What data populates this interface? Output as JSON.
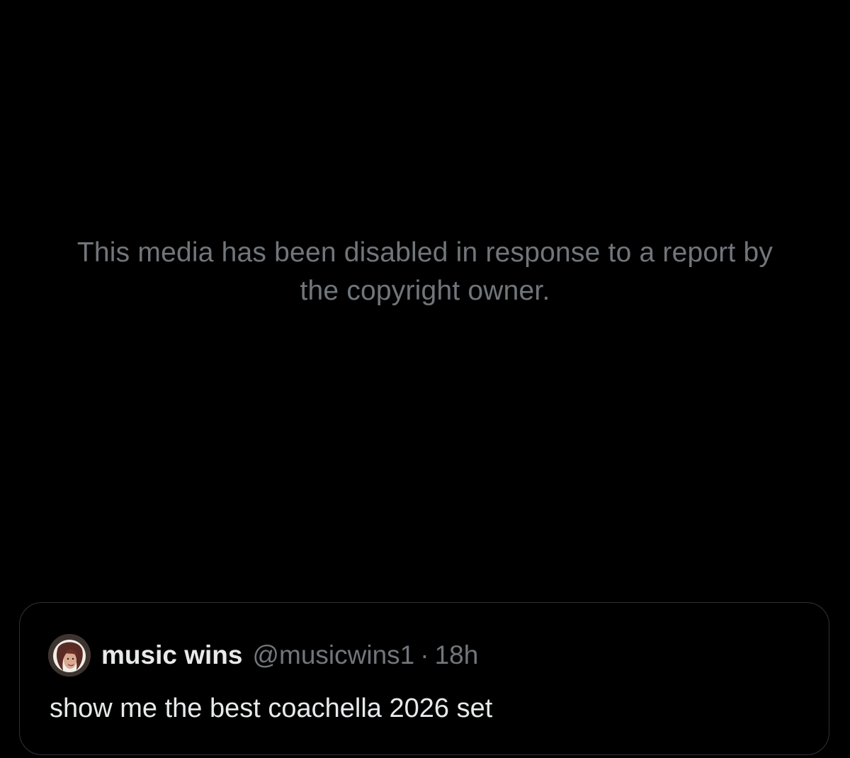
{
  "media": {
    "disabled_notice": "This media has been disabled in response to a report by the copyright owner."
  },
  "quoted_post": {
    "author_name": "music wins",
    "author_handle": "@musicwins1",
    "separator": "·",
    "timestamp": "18h",
    "text": "show me the best coachella 2026 set",
    "avatar_icon": "profile-avatar-icon"
  },
  "colors": {
    "background": "#000000",
    "primary_text": "#e7e9ea",
    "secondary_text": "#71767b",
    "card_border": "#2f3336"
  }
}
